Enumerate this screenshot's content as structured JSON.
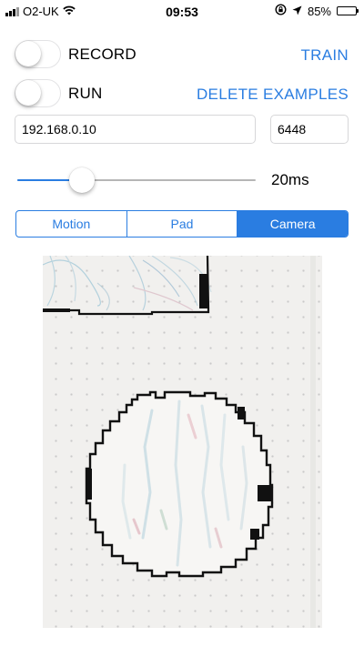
{
  "status_bar": {
    "carrier": "O2-UK",
    "time": "09:53",
    "battery": "85%",
    "battery_level": 0.85
  },
  "controls": {
    "record_label": "RECORD",
    "record_on": false,
    "run_label": "RUN",
    "run_on": false,
    "train_label": "TRAIN",
    "delete_label": "DELETE EXAMPLES"
  },
  "connection": {
    "ip_value": "192.168.0.10",
    "port_value": "6448"
  },
  "slider": {
    "value_label": "20ms",
    "position_fraction": 0.27
  },
  "tabs": [
    {
      "label": "Motion",
      "selected": false
    },
    {
      "label": "Pad",
      "selected": false
    },
    {
      "label": "Camera",
      "selected": true
    }
  ],
  "colors": {
    "accent": "#2a7de1",
    "paper": "#f1f0ee"
  }
}
